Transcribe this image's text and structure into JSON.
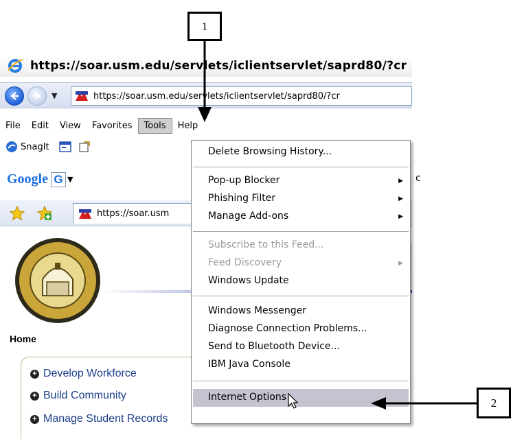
{
  "callouts": [
    {
      "label": "1"
    },
    {
      "label": "2"
    }
  ],
  "browser": {
    "title": "https://soar.usm.edu/servlets/iclientservlet/saprd80/?cr",
    "address": "https://soar.usm.edu/servlets/iclientservlet/saprd80/?cr",
    "tab_title": "https://soar.usm"
  },
  "menu_bar": [
    "File",
    "Edit",
    "View",
    "Favorites",
    "Tools",
    "Help"
  ],
  "snagit_label": "SnagIt",
  "google_logo": "Google",
  "google_button": "G",
  "tools_menu": {
    "delete_history": "Delete Browsing History...",
    "popup_blocker": "Pop-up Blocker",
    "phishing_filter": "Phishing Filter",
    "manage_addons": "Manage Add-ons",
    "subscribe_feed": "Subscribe to this Feed...",
    "feed_discovery": "Feed Discovery",
    "windows_update": "Windows Update",
    "windows_messenger": "Windows Messenger",
    "diagnose": "Diagnose Connection Problems...",
    "bluetooth": "Send to Bluetooth Device...",
    "java_console": "IBM Java Console",
    "internet_options": "Internet Options"
  },
  "page": {
    "home": "Home",
    "links": [
      "Develop Workforce",
      "Build Community",
      "Manage Student Records"
    ],
    "right_peek": "c"
  },
  "icons": {
    "browser_logo": "ie-logo-icon",
    "back": "back-arrow-icon",
    "forward": "forward-arrow-icon",
    "favorites": "star-icon",
    "add_favorite": "add-star-icon",
    "cursor": "mouse-pointer-icon"
  }
}
